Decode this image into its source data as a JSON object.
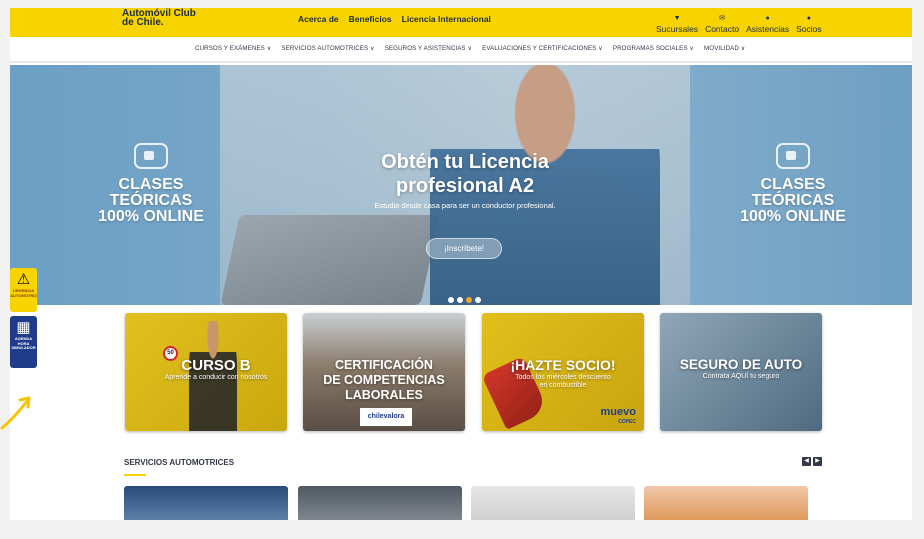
{
  "topbar": {
    "logo": [
      "Automóvil Club",
      "de Chile."
    ],
    "links": [
      "Acerca de",
      "Beneficios",
      "Licencia Internacional"
    ],
    "right_links": [
      {
        "label": "Sucursales",
        "icon": "location-icon"
      },
      {
        "label": "Contacto",
        "icon": "mail-icon"
      },
      {
        "label": "Asistencias",
        "icon": "phone-icon"
      },
      {
        "label": "Socios",
        "icon": "user-icon"
      }
    ]
  },
  "nav": {
    "items": [
      "CURSOS Y EXÁMENES ∨",
      "SERVICIOS AUTOMOTRICES ∨",
      "SEGUROS Y ASISTENCIAS ∨",
      "EVALUACIONES Y CERTIFICACIONES ∨",
      "PROGRAMAS SOCIALES ∨",
      "MOVILIDAD ∨"
    ]
  },
  "hero": {
    "left_line1": "CLASES TEÓRICAS",
    "left_line2": "100% ONLINE",
    "right_line1": "CLASES TEÓRICAS",
    "right_line2": "100% ONLINE",
    "title1": "Obtén tu Licencia",
    "title2": "profesional A2",
    "subtitle": "Estudia desde casa para ser un conductor profesional.",
    "cta": "¡Inscríbete!",
    "active_slide": 2
  },
  "floatbar": {
    "urgencia": "URGENCIA AUTOMOTRIZ",
    "agenda": [
      "AGENDA",
      "HORA",
      "SIMULADOR"
    ]
  },
  "cards": {
    "curso": {
      "title": "CURSO B",
      "subtitle": "Aprende a conducir con nosotros",
      "badge": "50"
    },
    "cert": {
      "title1": "CERTIFICACIÓN",
      "title2": "DE COMPETENCIAS",
      "title3": "LABORALES",
      "logo": "chilevalora"
    },
    "socio": {
      "title": "¡HAZTE SOCIO!",
      "sub1": "Todos los miércoles descuento",
      "sub2": "en combustible",
      "brand": "muevo",
      "brand_sub": "COPEC"
    },
    "seguro": {
      "title": "SEGURO DE AUTO",
      "subtitle": "Contrata AQUÍ tu seguro"
    }
  },
  "services": {
    "title": "SERVICIOS AUTOMOTRICES",
    "prev": "◀",
    "next": "▶"
  },
  "colors": {
    "brand_yellow": "#f7d300",
    "navy": "#1f3c8a",
    "text_dark": "#33384a"
  }
}
